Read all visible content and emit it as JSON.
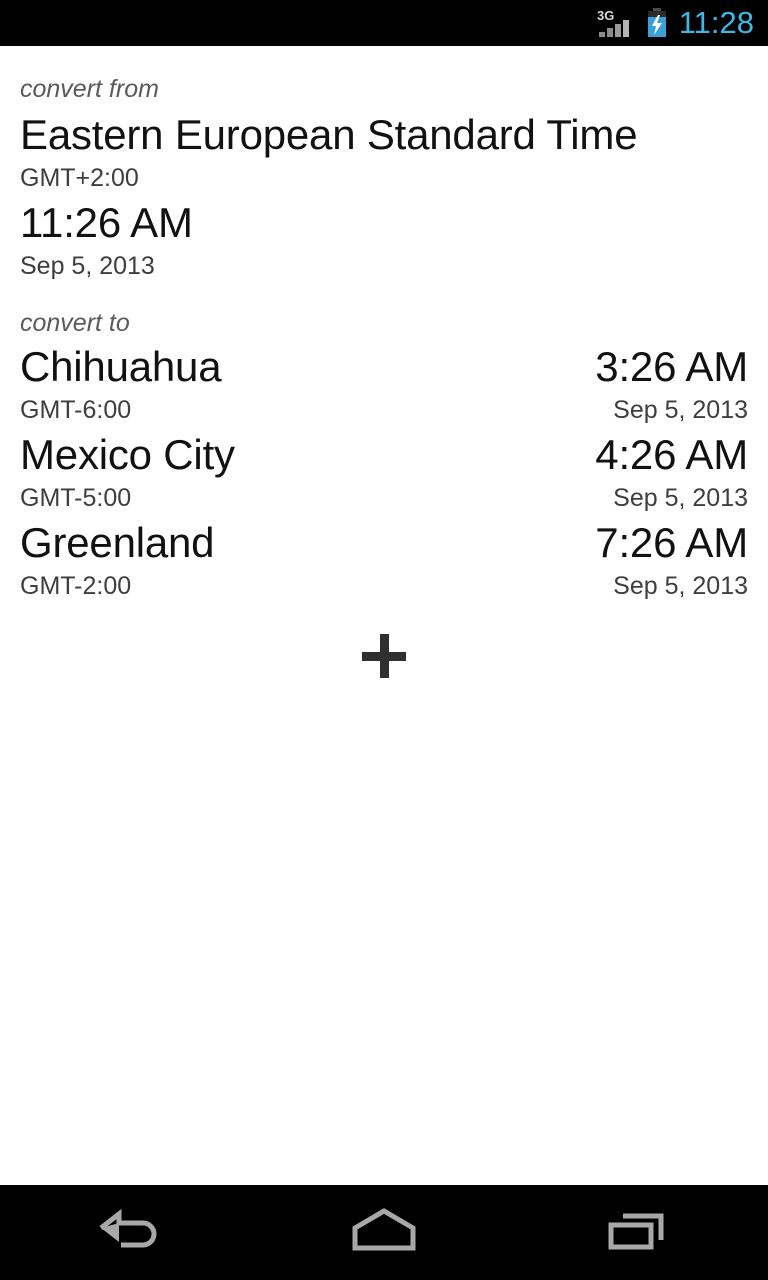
{
  "status_bar": {
    "network_label": "3G",
    "signal_icon": "signal-bars-icon",
    "battery_icon": "battery-charging-icon",
    "clock": "11:28",
    "clock_color": "#3cb8e8",
    "background": "#000000"
  },
  "app": {
    "from_section": {
      "label": "convert from",
      "zone_name": "Eastern European Standard Time",
      "gmt_offset": "GMT+2:00",
      "time": "11:26 AM",
      "date": "Sep 5, 2013"
    },
    "to_section": {
      "label": "convert to",
      "rows": [
        {
          "city": "Chihuahua",
          "gmt_offset": "GMT-6:00",
          "time": "3:26 AM",
          "date": "Sep 5, 2013"
        },
        {
          "city": "Mexico City",
          "gmt_offset": "GMT-5:00",
          "time": "4:26 AM",
          "date": "Sep 5, 2013"
        },
        {
          "city": "Greenland",
          "gmt_offset": "GMT-2:00",
          "time": "7:26 AM",
          "date": "Sep 5, 2013"
        }
      ]
    },
    "add_button": {
      "icon": "plus-icon",
      "color": "#2f2f2f"
    }
  },
  "nav_bar": {
    "back_icon": "back-arrow-icon",
    "home_icon": "home-icon",
    "recents_icon": "recent-apps-icon",
    "icon_color": "#a8a8a8",
    "background": "#000000"
  }
}
